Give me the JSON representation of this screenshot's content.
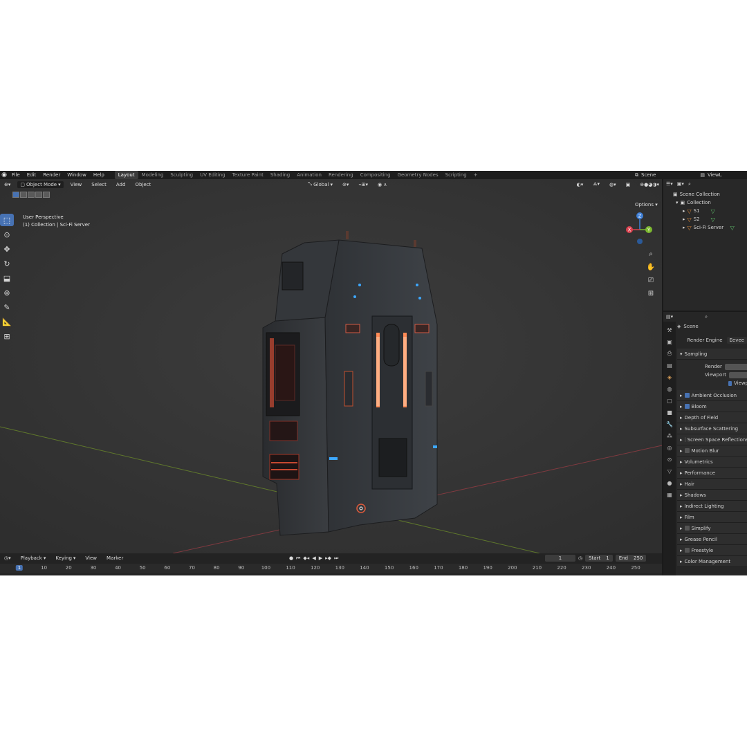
{
  "menu": {
    "items": [
      "File",
      "Edit",
      "Render",
      "Window",
      "Help"
    ],
    "workspaces": [
      "Layout",
      "Modeling",
      "Sculpting",
      "UV Editing",
      "Texture Paint",
      "Shading",
      "Animation",
      "Rendering",
      "Compositing",
      "Geometry Nodes",
      "Scripting"
    ],
    "active_workspace": "Layout",
    "add_tab": "+",
    "scene": "Scene",
    "view_layer": "ViewL"
  },
  "viewport": {
    "mode": "Object Mode",
    "menus": [
      "View",
      "Select",
      "Add",
      "Object"
    ],
    "orientation": "Global",
    "options": "Options",
    "view_name": "User Perspective",
    "view_context": "(1) Collection | Sci-Fi Server",
    "gizmo": {
      "x": "X",
      "y": "Y",
      "z": "Z"
    }
  },
  "timeline": {
    "menus": [
      "Playback",
      "Keying",
      "View",
      "Marker"
    ],
    "current_frame": "1",
    "start_label": "Start",
    "start": "1",
    "end_label": "End",
    "end": "250",
    "ticks": [
      "1",
      "10",
      "20",
      "30",
      "40",
      "50",
      "60",
      "70",
      "80",
      "90",
      "100",
      "110",
      "120",
      "130",
      "140",
      "150",
      "160",
      "170",
      "180",
      "190",
      "200",
      "210",
      "220",
      "230",
      "240",
      "250"
    ]
  },
  "outliner": {
    "scene_collection": "Scene Collection",
    "collection": "Collection",
    "objects": [
      "S1",
      "S2",
      "Sci-Fi Server"
    ]
  },
  "properties": {
    "context": "Scene",
    "render_engine_label": "Render Engine",
    "render_engine": "Eevee",
    "sampling": "Sampling",
    "render_label": "Render",
    "viewport_label": "Viewport",
    "viewport_denoise": "Viewp",
    "panels": [
      {
        "label": "Ambient Occlusion",
        "checkbox": true
      },
      {
        "label": "Bloom",
        "checkbox": true
      },
      {
        "label": "Depth of Field",
        "checkbox": null
      },
      {
        "label": "Subsurface Scattering",
        "checkbox": null
      },
      {
        "label": "Screen Space Reflections",
        "checkbox": false
      },
      {
        "label": "Motion Blur",
        "checkbox": false
      },
      {
        "label": "Volumetrics",
        "checkbox": null
      },
      {
        "label": "Performance",
        "checkbox": null
      },
      {
        "label": "Hair",
        "checkbox": null
      },
      {
        "label": "Shadows",
        "checkbox": null
      },
      {
        "label": "Indirect Lighting",
        "checkbox": null
      },
      {
        "label": "Film",
        "checkbox": null
      },
      {
        "label": "Simplify",
        "checkbox": false
      },
      {
        "label": "Grease Pencil",
        "checkbox": null
      },
      {
        "label": "Freestyle",
        "checkbox": false
      },
      {
        "label": "Color Management",
        "checkbox": null
      }
    ]
  },
  "colors": {
    "accent": "#4772b3",
    "axis_x": "#d9414e",
    "axis_y": "#7cb82f",
    "axis_z": "#3f7fd6",
    "server_glow": "#ff6a3d"
  }
}
